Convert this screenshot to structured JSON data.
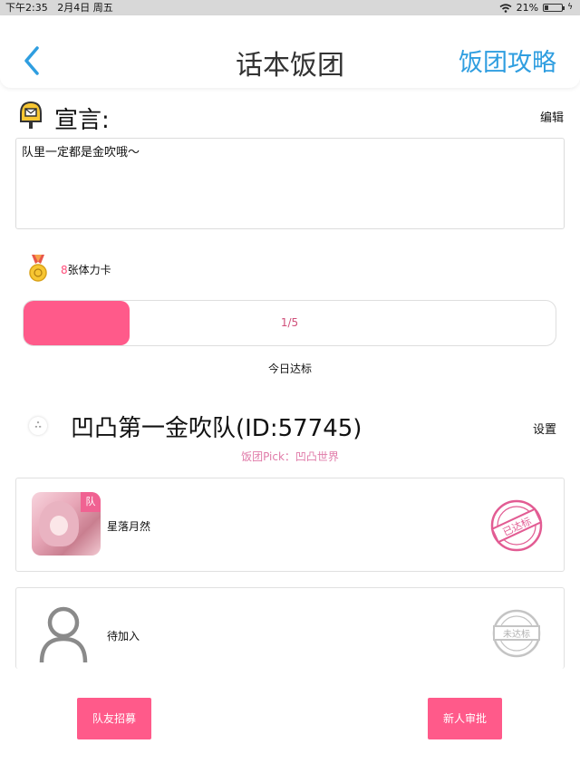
{
  "status_bar": {
    "time": "下午2:35",
    "date": "2月4日 周五",
    "battery_percent": "21%",
    "battery_level": 0.21
  },
  "nav": {
    "title": "话本饭团",
    "right_link": "饭团攻略"
  },
  "declaration": {
    "title": "宣言:",
    "edit_label": "编辑",
    "text": "队里一定都是金吹哦～"
  },
  "stamina": {
    "count": "8",
    "label": "张体力卡"
  },
  "progress": {
    "text": "1/5",
    "fraction": 0.2,
    "caption": "今日达标"
  },
  "team": {
    "name": "凹凸第一金吹队(ID:57745)",
    "settings_label": "设置",
    "pick": "饭团Pick：凹凸世界"
  },
  "members": [
    {
      "name": "星落月然",
      "badge": "队",
      "status": "已达标"
    },
    {
      "name": "待加入",
      "status": "未达标"
    }
  ],
  "buttons": {
    "recruit": "队友招募",
    "approve": "新人审批"
  },
  "colors": {
    "accent_pink": "#ff5a8a",
    "link_blue": "#2f9ee0",
    "pick_pink": "#e07aa8"
  }
}
